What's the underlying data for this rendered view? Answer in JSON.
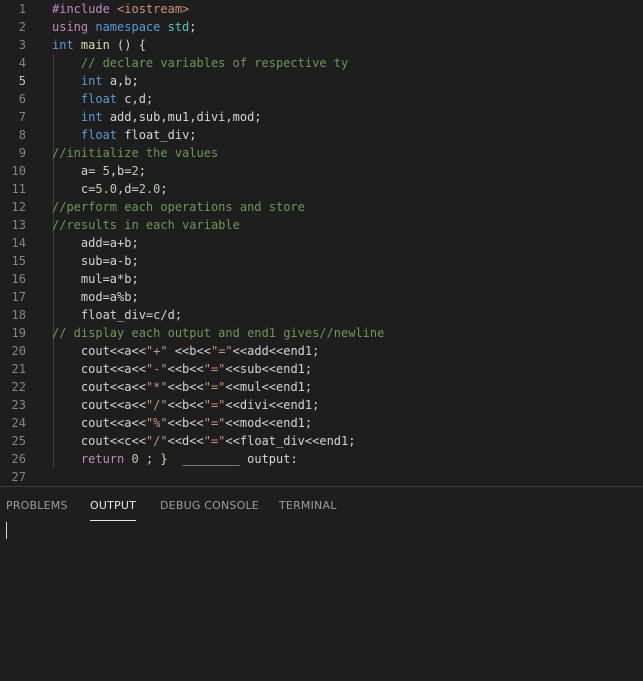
{
  "editor": {
    "current_line": 5,
    "lines": [
      {
        "n": "1",
        "tokens": [
          [
            "ctrl",
            "#include "
          ],
          [
            "str",
            "<iostream>"
          ]
        ]
      },
      {
        "n": "2",
        "tokens": [
          [
            "ctrl",
            "using "
          ],
          [
            "kw",
            "namespace "
          ],
          [
            "type",
            "std"
          ],
          [
            "plain",
            ";"
          ]
        ]
      },
      {
        "n": "3",
        "tokens": [
          [
            "kw",
            "int "
          ],
          [
            "fn",
            "main "
          ],
          [
            "plain",
            "() {"
          ]
        ]
      },
      {
        "n": "4",
        "tokens": [
          [
            "plain",
            "    "
          ],
          [
            "cmt",
            "// declare variables of respective ty"
          ]
        ]
      },
      {
        "n": "5",
        "tokens": [
          [
            "plain",
            "    "
          ],
          [
            "kw",
            "int "
          ],
          [
            "plain",
            "a,b;"
          ]
        ]
      },
      {
        "n": "6",
        "tokens": [
          [
            "plain",
            "    "
          ],
          [
            "kw",
            "float "
          ],
          [
            "plain",
            "c,d;"
          ]
        ]
      },
      {
        "n": "7",
        "tokens": [
          [
            "plain",
            "    "
          ],
          [
            "kw",
            "int "
          ],
          [
            "plain",
            "add,sub,mu1,divi,mod;"
          ]
        ]
      },
      {
        "n": "8",
        "tokens": [
          [
            "plain",
            "    "
          ],
          [
            "kw",
            "float "
          ],
          [
            "plain",
            "float_div;"
          ]
        ]
      },
      {
        "n": "9",
        "tokens": [
          [
            "cmt",
            "//initialize the values"
          ]
        ]
      },
      {
        "n": "10",
        "tokens": [
          [
            "plain",
            "    a= "
          ],
          [
            "num",
            "5"
          ],
          [
            "plain",
            ",b="
          ],
          [
            "num",
            "2"
          ],
          [
            "plain",
            ";"
          ]
        ]
      },
      {
        "n": "11",
        "tokens": [
          [
            "plain",
            "    c="
          ],
          [
            "num",
            "5.0"
          ],
          [
            "plain",
            ",d="
          ],
          [
            "num",
            "2.0"
          ],
          [
            "plain",
            ";"
          ]
        ]
      },
      {
        "n": "12",
        "tokens": [
          [
            "cmt",
            "//perform each operations and store"
          ]
        ]
      },
      {
        "n": "13",
        "tokens": [
          [
            "cmt",
            "//results in each variable"
          ]
        ]
      },
      {
        "n": "14",
        "tokens": [
          [
            "plain",
            "    add=a+b;"
          ]
        ]
      },
      {
        "n": "15",
        "tokens": [
          [
            "plain",
            "    sub=a-b;"
          ]
        ]
      },
      {
        "n": "16",
        "tokens": [
          [
            "plain",
            "    mul=a*b;"
          ]
        ]
      },
      {
        "n": "17",
        "tokens": [
          [
            "plain",
            "    mod=a%b;"
          ]
        ]
      },
      {
        "n": "18",
        "tokens": [
          [
            "plain",
            "    float_div=c/d;"
          ]
        ]
      },
      {
        "n": "19",
        "tokens": [
          [
            "cmt",
            "// display each output and end1 gives//newline"
          ]
        ]
      },
      {
        "n": "20",
        "tokens": [
          [
            "plain",
            "    cout<<a<<"
          ],
          [
            "str",
            "\"+\""
          ],
          [
            "plain",
            " <<b<<"
          ],
          [
            "str",
            "\"=\""
          ],
          [
            "plain",
            "<<add<<end1;"
          ]
        ]
      },
      {
        "n": "21",
        "tokens": [
          [
            "plain",
            "    cout<<a<<"
          ],
          [
            "str",
            "\"-\""
          ],
          [
            "plain",
            "<<b<<"
          ],
          [
            "str",
            "\"=\""
          ],
          [
            "plain",
            "<<sub<<end1;"
          ]
        ]
      },
      {
        "n": "22",
        "tokens": [
          [
            "plain",
            "    cout<<a<<"
          ],
          [
            "str",
            "\"*\""
          ],
          [
            "plain",
            "<<b<<"
          ],
          [
            "str",
            "\"=\""
          ],
          [
            "plain",
            "<<mul<<end1;"
          ]
        ]
      },
      {
        "n": "23",
        "tokens": [
          [
            "plain",
            "    cout<<a<<"
          ],
          [
            "str",
            "\"/\""
          ],
          [
            "plain",
            "<<b<<"
          ],
          [
            "str",
            "\"=\""
          ],
          [
            "plain",
            "<<divi<<end1;"
          ]
        ]
      },
      {
        "n": "24",
        "tokens": [
          [
            "plain",
            "    cout<<a<<"
          ],
          [
            "str",
            "\"%\""
          ],
          [
            "plain",
            "<<b<<"
          ],
          [
            "str",
            "\"=\""
          ],
          [
            "plain",
            "<<mod<<end1;"
          ]
        ]
      },
      {
        "n": "25",
        "tokens": [
          [
            "plain",
            "    cout<<c<<"
          ],
          [
            "str",
            "\"/\""
          ],
          [
            "plain",
            "<<d<<"
          ],
          [
            "str",
            "\"=\""
          ],
          [
            "plain",
            "<<float_div<<end1;"
          ]
        ]
      },
      {
        "n": "26",
        "tokens": [
          [
            "plain",
            "    "
          ],
          [
            "ctrl",
            "return "
          ],
          [
            "num",
            "0"
          ],
          [
            "plain",
            " ; "
          ],
          [
            "fn",
            "}"
          ],
          [
            "plain",
            "  ________ output:"
          ]
        ]
      },
      {
        "n": "27",
        "tokens": []
      }
    ]
  },
  "panel": {
    "tabs": [
      {
        "label": "PROBLEMS",
        "active": false
      },
      {
        "label": "OUTPUT",
        "active": true
      },
      {
        "label": "DEBUG CONSOLE",
        "active": false
      },
      {
        "label": "TERMINAL",
        "active": false
      }
    ]
  },
  "colors": {
    "background": "#1e1e1e",
    "keyword": "#569cd6",
    "control": "#c586c0",
    "string": "#ce9178",
    "number": "#b5cea8",
    "comment": "#6a9955"
  }
}
